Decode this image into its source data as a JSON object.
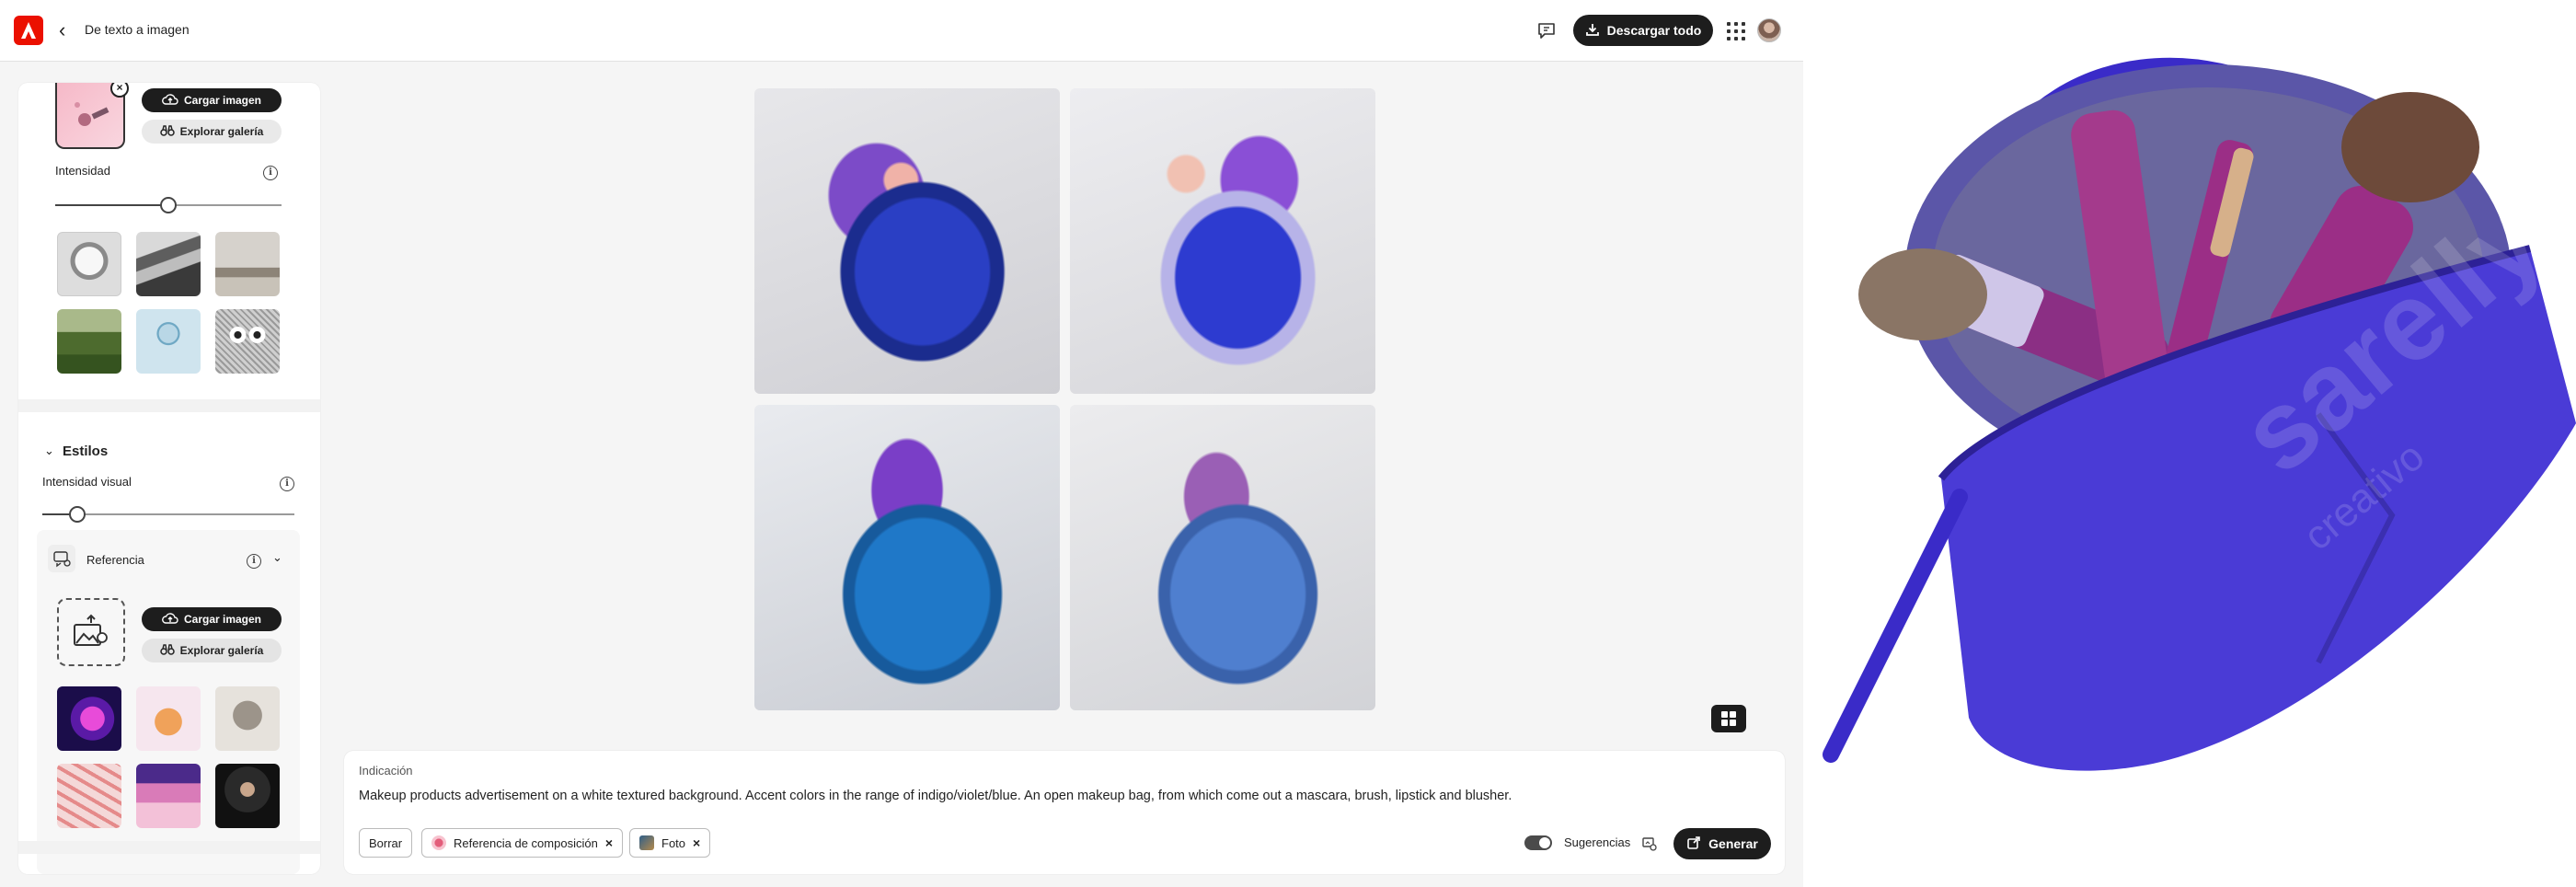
{
  "header": {
    "title": "De texto a imagen",
    "download_label": "Descargar todo"
  },
  "sidebar": {
    "composition": {
      "upload_label": "Cargar imagen",
      "gallery_label": "Explorar galería",
      "intensity_label": "Intensidad",
      "intensity_level": 0.5
    },
    "styles": {
      "title": "Estilos",
      "visual_intensity_label": "Intensidad visual",
      "visual_intensity_level": 0.14,
      "reference_label": "Referencia",
      "upload_label": "Cargar imagen",
      "gallery_label": "Explorar galería"
    }
  },
  "prompt": {
    "label": "Indicación",
    "text": "Makeup products advertisement on a white textured background. Accent colors in the range of indigo/violet/blue. An open makeup bag, from which come out a mascara, brush, lipstick and blusher.",
    "clear_label": "Borrar",
    "chips": [
      {
        "label": "Referencia de composición"
      },
      {
        "label": "Foto"
      }
    ],
    "suggestions_label": "Sugerencias",
    "generate_label": "Generar"
  },
  "preview_watermark": "sarelly",
  "preview_watermark_sub": "creativo",
  "colors": {
    "adobe_red": "#eb1000",
    "dark_button": "#1d1d1d",
    "indigo_bag": "#4a3bd6"
  }
}
